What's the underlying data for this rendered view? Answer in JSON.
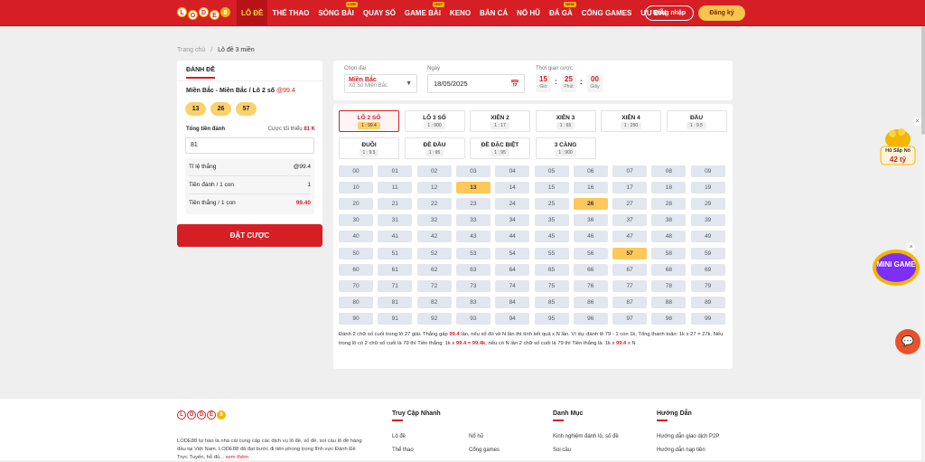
{
  "colors": {
    "brand_red": "#d61e25",
    "selected_number": "#fcc85a",
    "chip_yellow": "#fcd06a"
  },
  "header": {
    "logo_letters": [
      "L",
      "O",
      "D",
      "E",
      "8"
    ],
    "menu": [
      {
        "label": "LÔ ĐỀ",
        "active": true,
        "tag": ""
      },
      {
        "label": "THỂ THAO",
        "active": false,
        "tag": ""
      },
      {
        "label": "SÒNG BÀI",
        "active": false,
        "tag": "LIVE"
      },
      {
        "label": "QUAY SỐ",
        "active": false,
        "tag": ""
      },
      {
        "label": "GAME BÀI",
        "active": false,
        "tag": "HOT"
      },
      {
        "label": "KENO",
        "active": false,
        "tag": ""
      },
      {
        "label": "BẮN CÁ",
        "active": false,
        "tag": ""
      },
      {
        "label": "NỔ HŨ",
        "active": false,
        "tag": ""
      },
      {
        "label": "ĐÁ GÀ",
        "active": false,
        "tag": "NEW"
      },
      {
        "label": "CỔNG GAMES",
        "active": false,
        "tag": ""
      },
      {
        "label": "ƯU ĐÃI",
        "active": false,
        "tag": ""
      }
    ],
    "login": "Đăng nhập",
    "register": "Đăng ký"
  },
  "breadcrumb": {
    "home": "Trang chủ",
    "sep": "/",
    "current": "Lô đề 3 miền"
  },
  "bet_panel": {
    "title": "ĐÁNH ĐỀ",
    "selection": "Miền Bắc - Miền Bắc / Lô 2 số",
    "selection_rate": "@99.4",
    "chips": [
      "13",
      "26",
      "57"
    ],
    "amount_label": "Tổng tiền đánh",
    "min_label": "Cược tối thiểu",
    "min_value": "81 K",
    "amount_value": "81",
    "summary": [
      {
        "label": "Tỉ lệ thắng",
        "value": "@99.4",
        "red": false
      },
      {
        "label": "Tiền đánh / 1 con",
        "value": "1",
        "red": false
      },
      {
        "label": "Tiền thắng / 1 con",
        "value": "99.40",
        "red": true
      }
    ],
    "submit": "ĐẶT CƯỢC"
  },
  "filters": {
    "region_label": "Chọn đài",
    "region_value": "Miền Bắc",
    "region_sub": "Xổ Số Miền Bắc",
    "date_label": "Ngày",
    "date_value": "18/05/2025",
    "time_label": "Thời gian cược",
    "time": [
      {
        "n": "15",
        "u": "Giờ"
      },
      {
        "n": "25",
        "u": "Phút"
      },
      {
        "n": "00",
        "u": "Giây"
      }
    ]
  },
  "bet_types": [
    {
      "name": "LÔ 2 SỐ",
      "rate": "1 : 99.4",
      "active": true
    },
    {
      "name": "LÔ 3 SỐ",
      "rate": "1 : 900",
      "active": false
    },
    {
      "name": "XIÊN 2",
      "rate": "1 : 17",
      "active": false
    },
    {
      "name": "XIÊN 3",
      "rate": "1 : 65",
      "active": false
    },
    {
      "name": "XIÊN 4",
      "rate": "1 : 250",
      "active": false
    },
    {
      "name": "ĐẦU",
      "rate": "1 : 9.5",
      "active": false
    },
    {
      "name": "ĐUÔI",
      "rate": "1 : 9.5",
      "active": false
    },
    {
      "name": "ĐỀ ĐẦU",
      "rate": "1 : 95",
      "active": false
    },
    {
      "name": "ĐỀ ĐẶC BIỆT",
      "rate": "1 : 95",
      "active": false
    },
    {
      "name": "3 CÀNG",
      "rate": "1 : 900",
      "active": false
    }
  ],
  "numbers": {
    "selected": [
      "13",
      "26",
      "57"
    ]
  },
  "description": {
    "p1": "Đánh 2 chữ số cuối trong lô 27 giải. Thắng gấp ",
    "r1": "99.4",
    "p2": " lần, nếu số đó về N lần thì tính kết quả x N lần. Ví dụ: đánh lô 79 - 1 con 1k, Tổng thanh toán: 1k x 27 = 27k. Nếu trong lô có 2 chữ số cuối là 79 thì Tiền thắng: 1k x ",
    "r2": "99.4 = 99.4k",
    "p3": ", nếu có N lần 2 chữ số cuối là 79 thì Tiền thắng là: 1k x ",
    "r3": "99.4",
    "p4": " x N"
  },
  "footer": {
    "about": "LODE88 tự hào là nhà cái cung cấp các dịch vụ lô đề, số đề, soi cầu lô đề hàng đầu tại Việt Nam. LODE88 đã đạt bước đi tiên phong trong lĩnh vực Đánh Đề Trực Tuyến, hỗ đủ...",
    "more": "xem thêm",
    "col1_title": "Truy Cập Nhanh",
    "col1_links": [
      "Lô đề",
      "Nổ hũ",
      "Thể thao",
      "Cổng games"
    ],
    "col2_title": "Danh Mục",
    "col2_links": [
      "Kinh nghiệm đánh lô, số đề",
      "Soi cầu"
    ],
    "col3_title": "Hướng Dẫn",
    "col3_links": [
      "Hướng dẫn giao dịch P2P",
      "Hướng dẫn nạp tiền"
    ]
  },
  "floating": {
    "jackpot_label": "Hũ Sắp Nổ",
    "jackpot_value": "42 tỷ",
    "minigame": "MINI GAME"
  }
}
